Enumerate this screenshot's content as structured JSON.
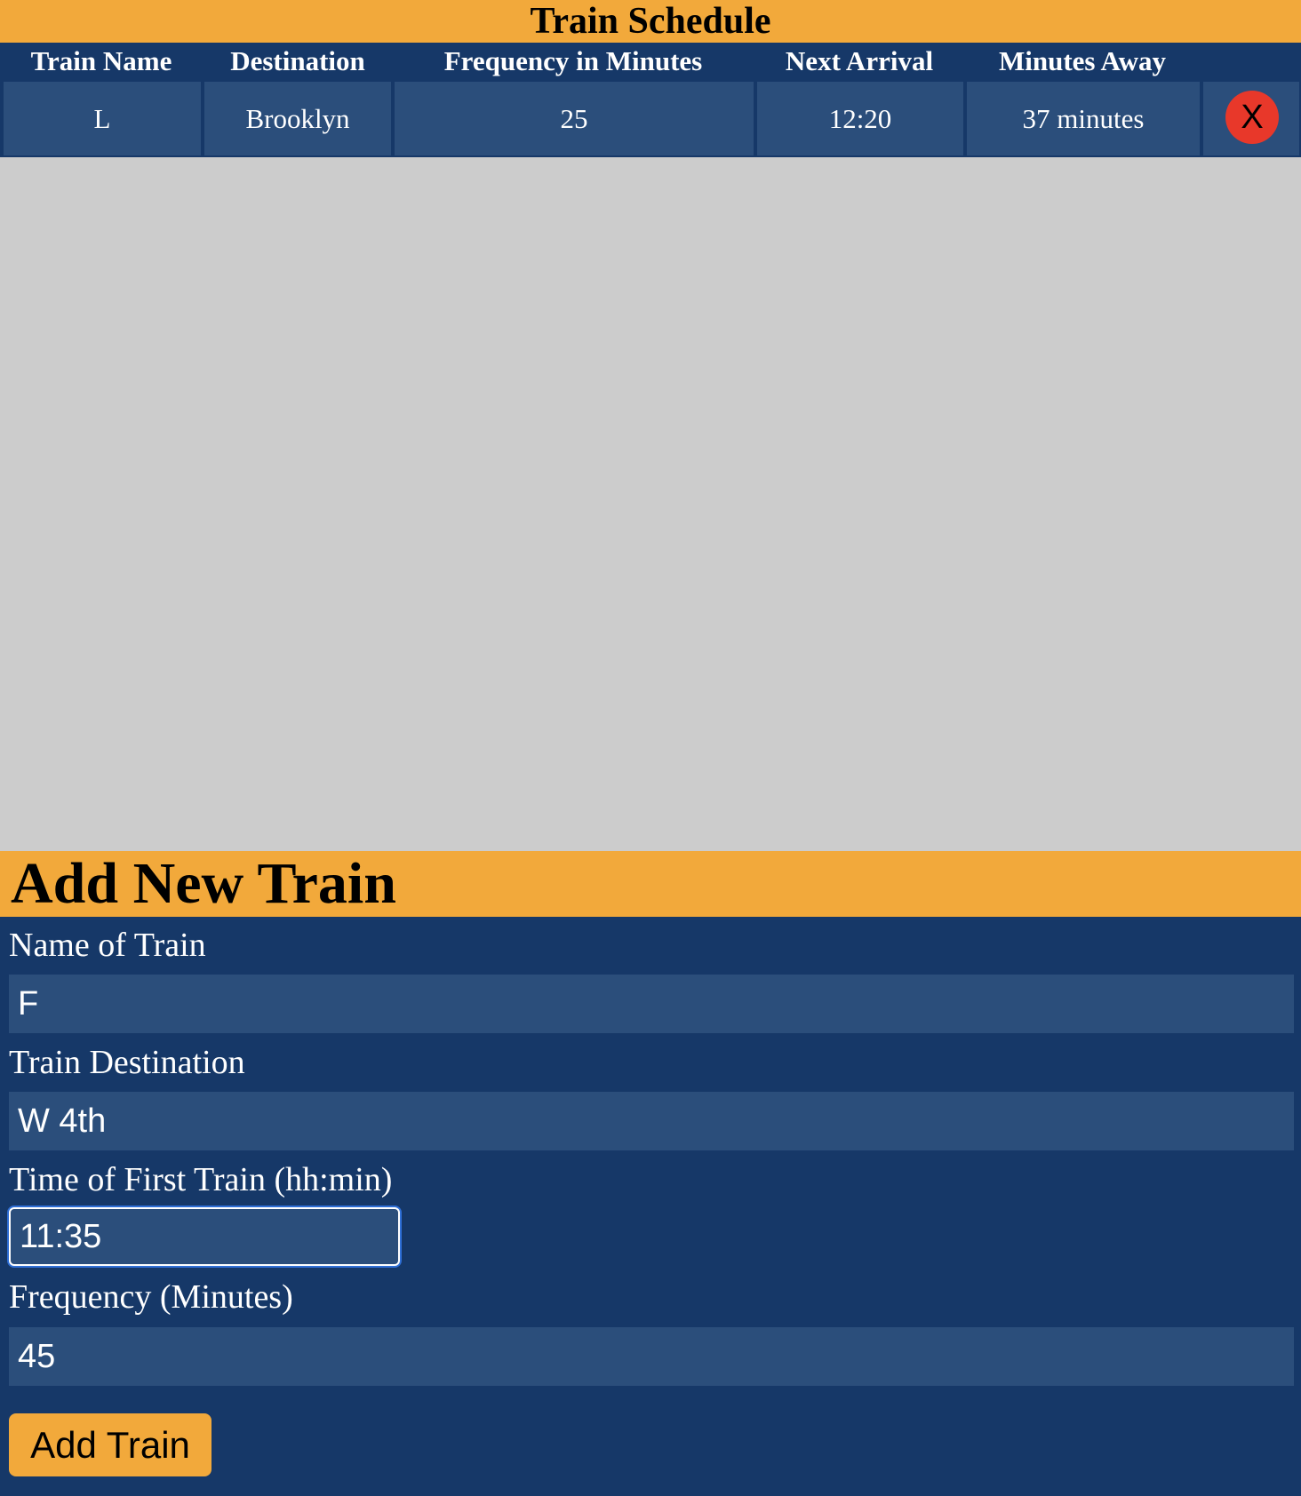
{
  "schedule": {
    "title": "Train Schedule",
    "columns": [
      "Train Name",
      "Destination",
      "Frequency in Minutes",
      "Next Arrival",
      "Minutes Away"
    ],
    "rows": [
      {
        "train_name": "L",
        "destination": "Brooklyn",
        "frequency": "25",
        "next_arrival": "12:20",
        "minutes_away": "37 minutes",
        "delete_label": "X"
      }
    ]
  },
  "form": {
    "title": "Add New Train",
    "name_label": "Name of Train",
    "name_value": "F",
    "destination_label": "Train Destination",
    "destination_value": "W 4th",
    "first_time_label": "Time of First Train (hh:min)",
    "first_time_value": "11:35",
    "frequency_label": "Frequency (Minutes)",
    "frequency_value": "45",
    "submit_label": "Add Train"
  },
  "colors": {
    "accent": "#f2a93b",
    "panel": "#163868",
    "cell": "#2b4e7b",
    "delete": "#e8382a",
    "empty_area": "#cccccc"
  }
}
